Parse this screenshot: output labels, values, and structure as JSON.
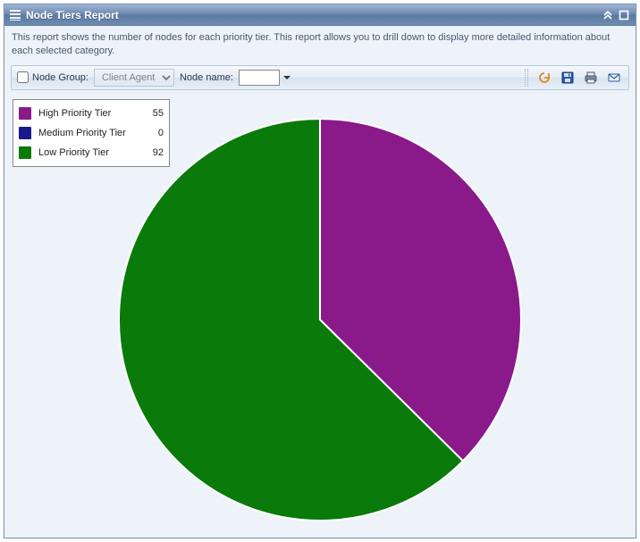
{
  "header": {
    "title": "Node Tiers Report"
  },
  "description": "This report shows the number of nodes for each priority tier. This report allows you to drill down to display more detailed information about each selected category.",
  "toolbar": {
    "node_group_label": "Node Group:",
    "node_group_selected": "Client Agent",
    "node_name_label": "Node name:",
    "node_name_value": ""
  },
  "chart_data": {
    "type": "pie",
    "title": "",
    "series": [
      {
        "name": "High Priority Tier",
        "value": 55,
        "color": "#8a1a8a"
      },
      {
        "name": "Medium Priority Tier",
        "value": 0,
        "color": "#1a1a8a"
      },
      {
        "name": "Low Priority Tier",
        "value": 92,
        "color": "#0a7a0a"
      }
    ]
  }
}
